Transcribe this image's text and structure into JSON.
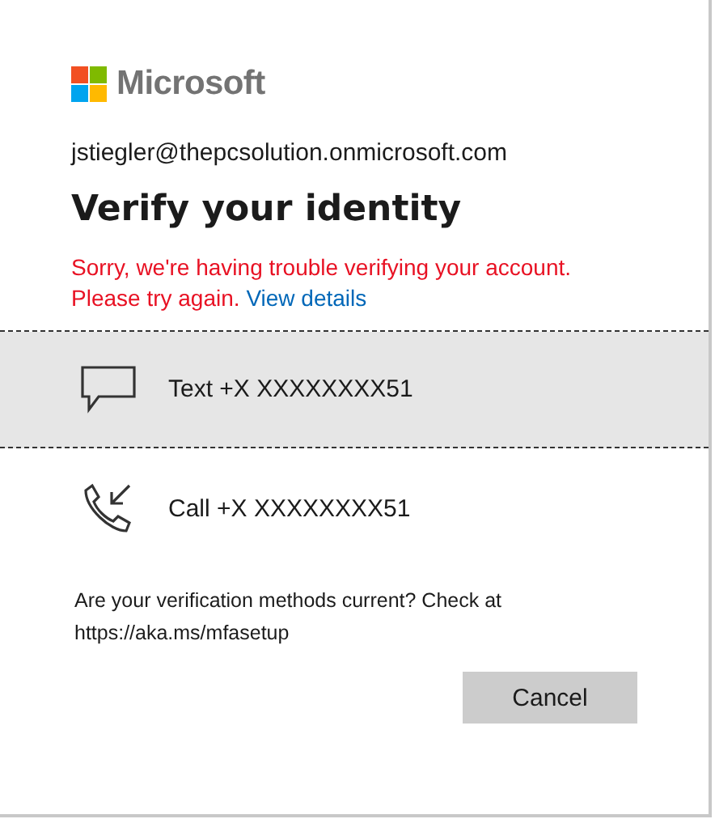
{
  "brand": {
    "name": "Microsoft"
  },
  "account": "jstiegler@thepcsolution.onmicrosoft.com",
  "title": "Verify your identity",
  "error": {
    "message": "Sorry, we're having trouble verifying your account. Please try again.",
    "link": "View details"
  },
  "methods": [
    {
      "kind": "text",
      "label": "Text +X XXXXXXXX51",
      "selected": true
    },
    {
      "kind": "call",
      "label": "Call +X XXXXXXXX51",
      "selected": false
    }
  ],
  "footer": "Are your verification methods current? Check at https://aka.ms/mfasetup",
  "buttons": [
    {
      "label": "Cancel"
    }
  ]
}
